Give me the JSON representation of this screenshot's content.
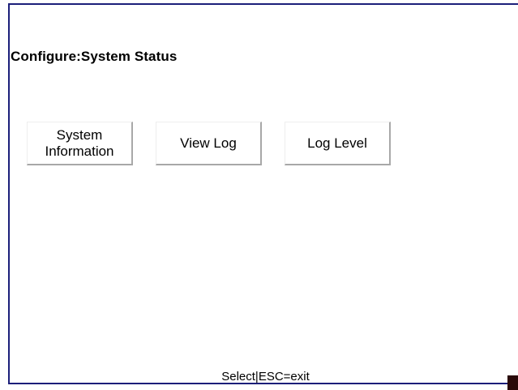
{
  "header": {
    "title": "Configure:System Status"
  },
  "menu": {
    "buttons": [
      {
        "label": "System\nInformation"
      },
      {
        "label": "View Log"
      },
      {
        "label": "Log Level"
      }
    ]
  },
  "status_bar": {
    "hint": "Select|ESC=exit"
  },
  "colors": {
    "frame_border": "#1c1f7a",
    "background": "#ffffff",
    "button_shadow": "#a8a8a8",
    "corner_mark": "#2a0909"
  }
}
